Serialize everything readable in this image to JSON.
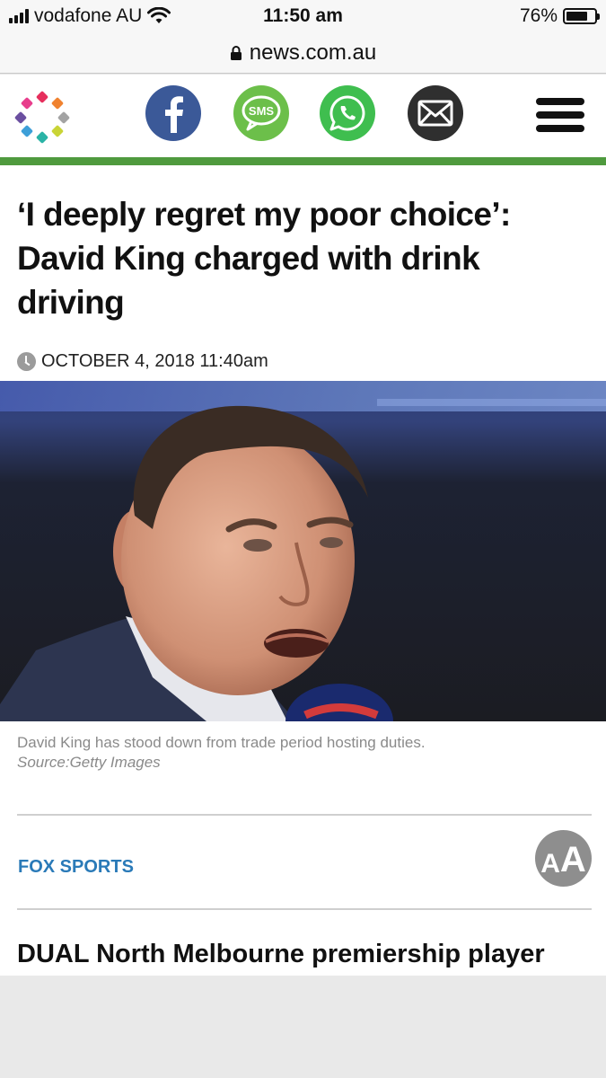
{
  "status_bar": {
    "carrier": "vodafone AU",
    "time": "11:50 am",
    "battery_percent": "76%",
    "battery_level": 0.76,
    "icons": [
      "signal-icon",
      "wifi-icon",
      "battery-icon"
    ]
  },
  "url_bar": {
    "domain": "news.com.au",
    "icon": "lock-icon"
  },
  "header": {
    "logo_icon": "dotted-ring-logo",
    "logo_colors": [
      "#e62e5c",
      "#f0822f",
      "#f5b41e",
      "#8cc641",
      "#2ab3a6",
      "#3d9fd8",
      "#6b4fa0",
      "#a3a3a3"
    ],
    "share_buttons": [
      {
        "name": "facebook",
        "icon": "facebook-icon",
        "color": "#3b5998"
      },
      {
        "name": "sms",
        "icon": "sms-icon",
        "label": "SMS",
        "color": "#6cbf4a"
      },
      {
        "name": "whatsapp",
        "icon": "whatsapp-icon",
        "color": "#3fbe4f"
      },
      {
        "name": "email",
        "icon": "mail-icon",
        "color": "#2f2f2f"
      }
    ],
    "menu_icon": "hamburger-menu-icon",
    "accent_color": "#4f9a3e"
  },
  "article": {
    "headline": "‘I deeply regret my poor choice’: David King charged with drink driving",
    "date": "OCTOBER 4, 2018 11:40am",
    "caption": "David King has stood down from trade period hosting duties.",
    "caption_source": "Source:Getty Images",
    "source_label": "FOX SPORTS",
    "source_color": "#2a7ab8",
    "font_size_button": {
      "small": "A",
      "large": "A"
    },
    "lead": "DUAL North Melbourne premiership player"
  }
}
